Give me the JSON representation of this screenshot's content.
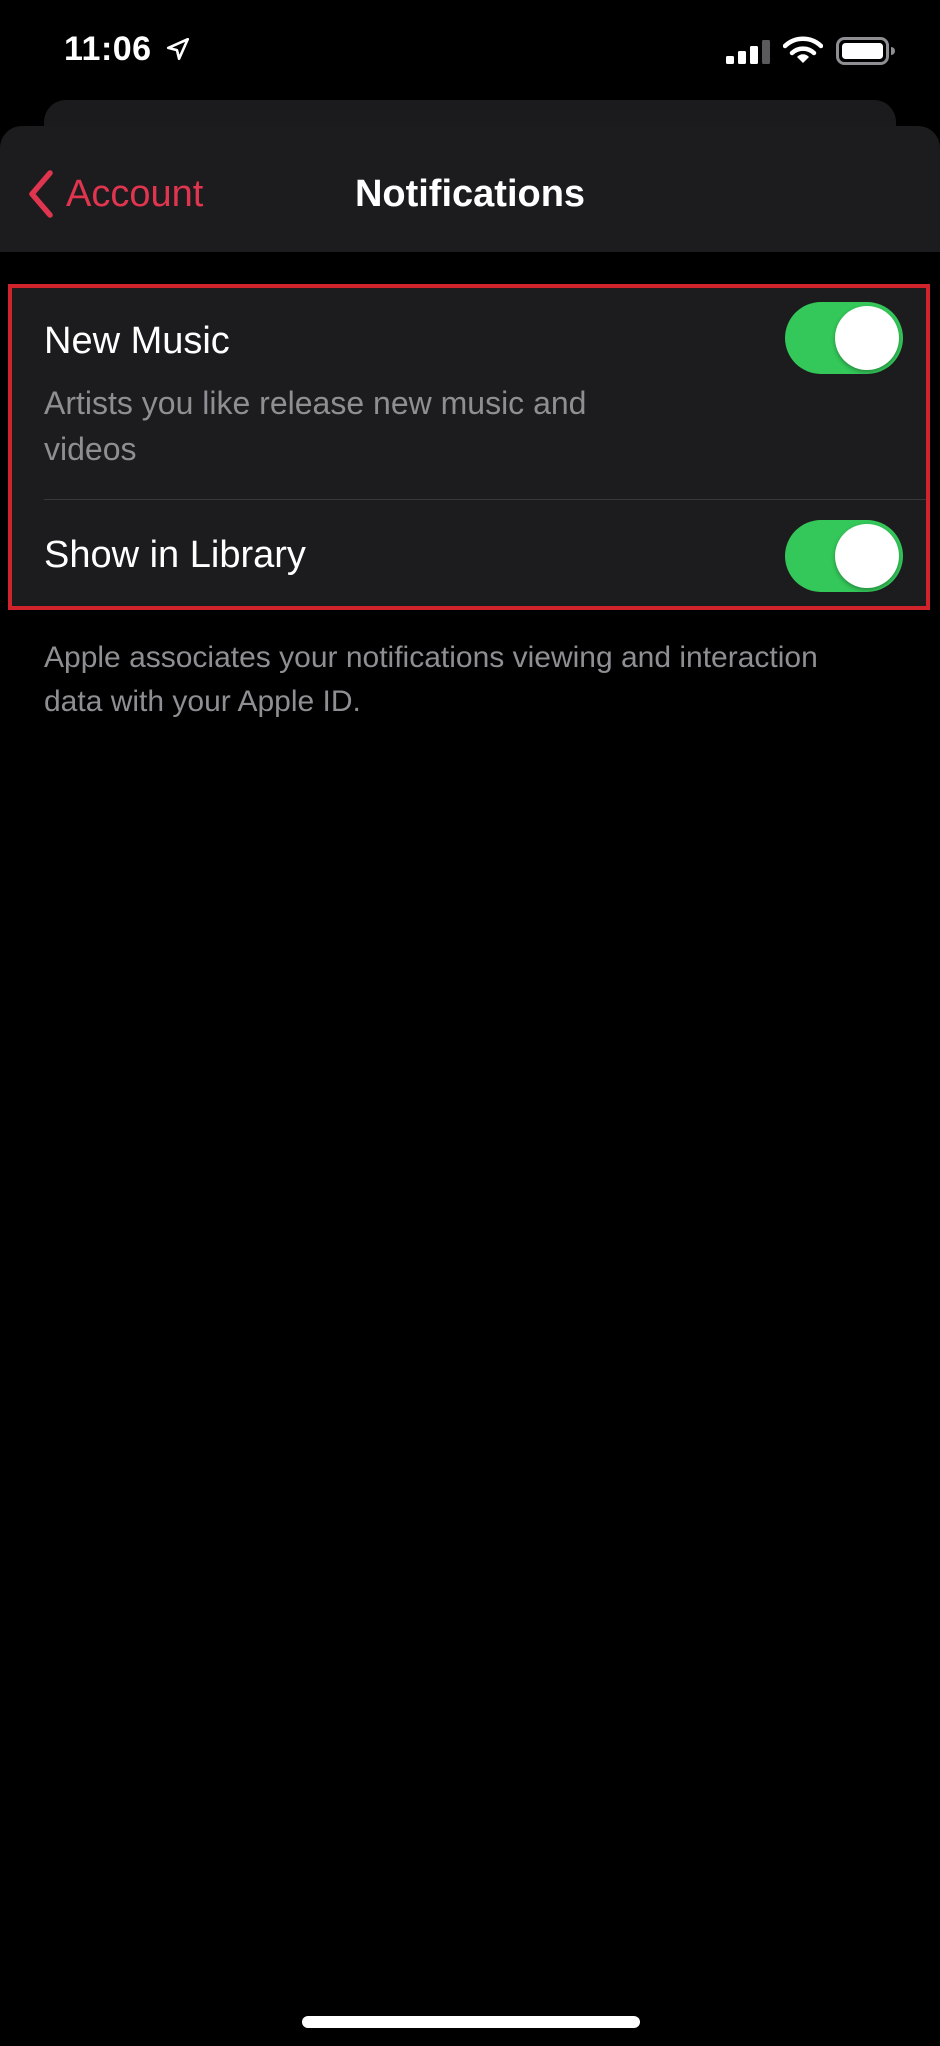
{
  "status_bar": {
    "time": "11:06"
  },
  "nav": {
    "back_label": "Account",
    "title": "Notifications"
  },
  "settings": {
    "new_music": {
      "title": "New Music",
      "subtitle": "Artists you like release new music and videos",
      "enabled": true
    },
    "show_in_library": {
      "title": "Show in Library",
      "enabled": true
    }
  },
  "footer_note": "Apple associates your notifications viewing and interaction data with your Apple ID.",
  "colors": {
    "accent": "#e0354f",
    "toggle_on": "#34c759",
    "highlight": "#d0232b",
    "group_background": "#1c1c1e"
  },
  "icons": {
    "location": "location-arrow-icon",
    "signal": "cellular-signal-icon",
    "wifi": "wifi-icon",
    "battery": "battery-icon",
    "back": "chevron-left-icon"
  }
}
